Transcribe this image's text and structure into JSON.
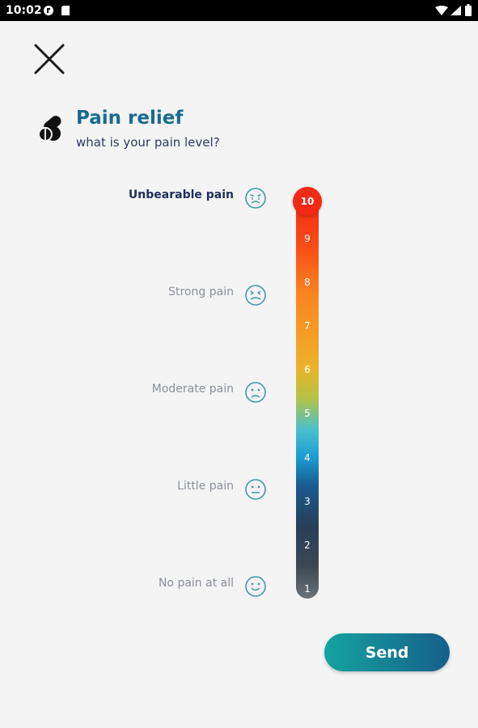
{
  "status_bar": {
    "time": "10:02"
  },
  "header": {
    "title": "Pain relief",
    "subtitle": "what is your pain level?"
  },
  "pain_levels": [
    {
      "label": "Unbearable pain",
      "face": "crying-face-icon"
    },
    {
      "label": "Strong pain",
      "face": "squinting-face-icon"
    },
    {
      "label": "Moderate pain",
      "face": "frowning-face-icon"
    },
    {
      "label": "Little pain",
      "face": "neutral-face-icon"
    },
    {
      "label": "No pain at all",
      "face": "smiling-face-icon"
    }
  ],
  "slider": {
    "selected_value": "10",
    "ticks": [
      "9",
      "8",
      "7",
      "6",
      "5",
      "4",
      "3",
      "2",
      "1"
    ]
  },
  "actions": {
    "send_label": "Send"
  },
  "colors": {
    "title": "#1a6a8f",
    "accent_start": "#14a4a0",
    "accent_end": "#175f8a",
    "slider_top": "#f12a16",
    "slider_bottom": "#6b7378"
  }
}
